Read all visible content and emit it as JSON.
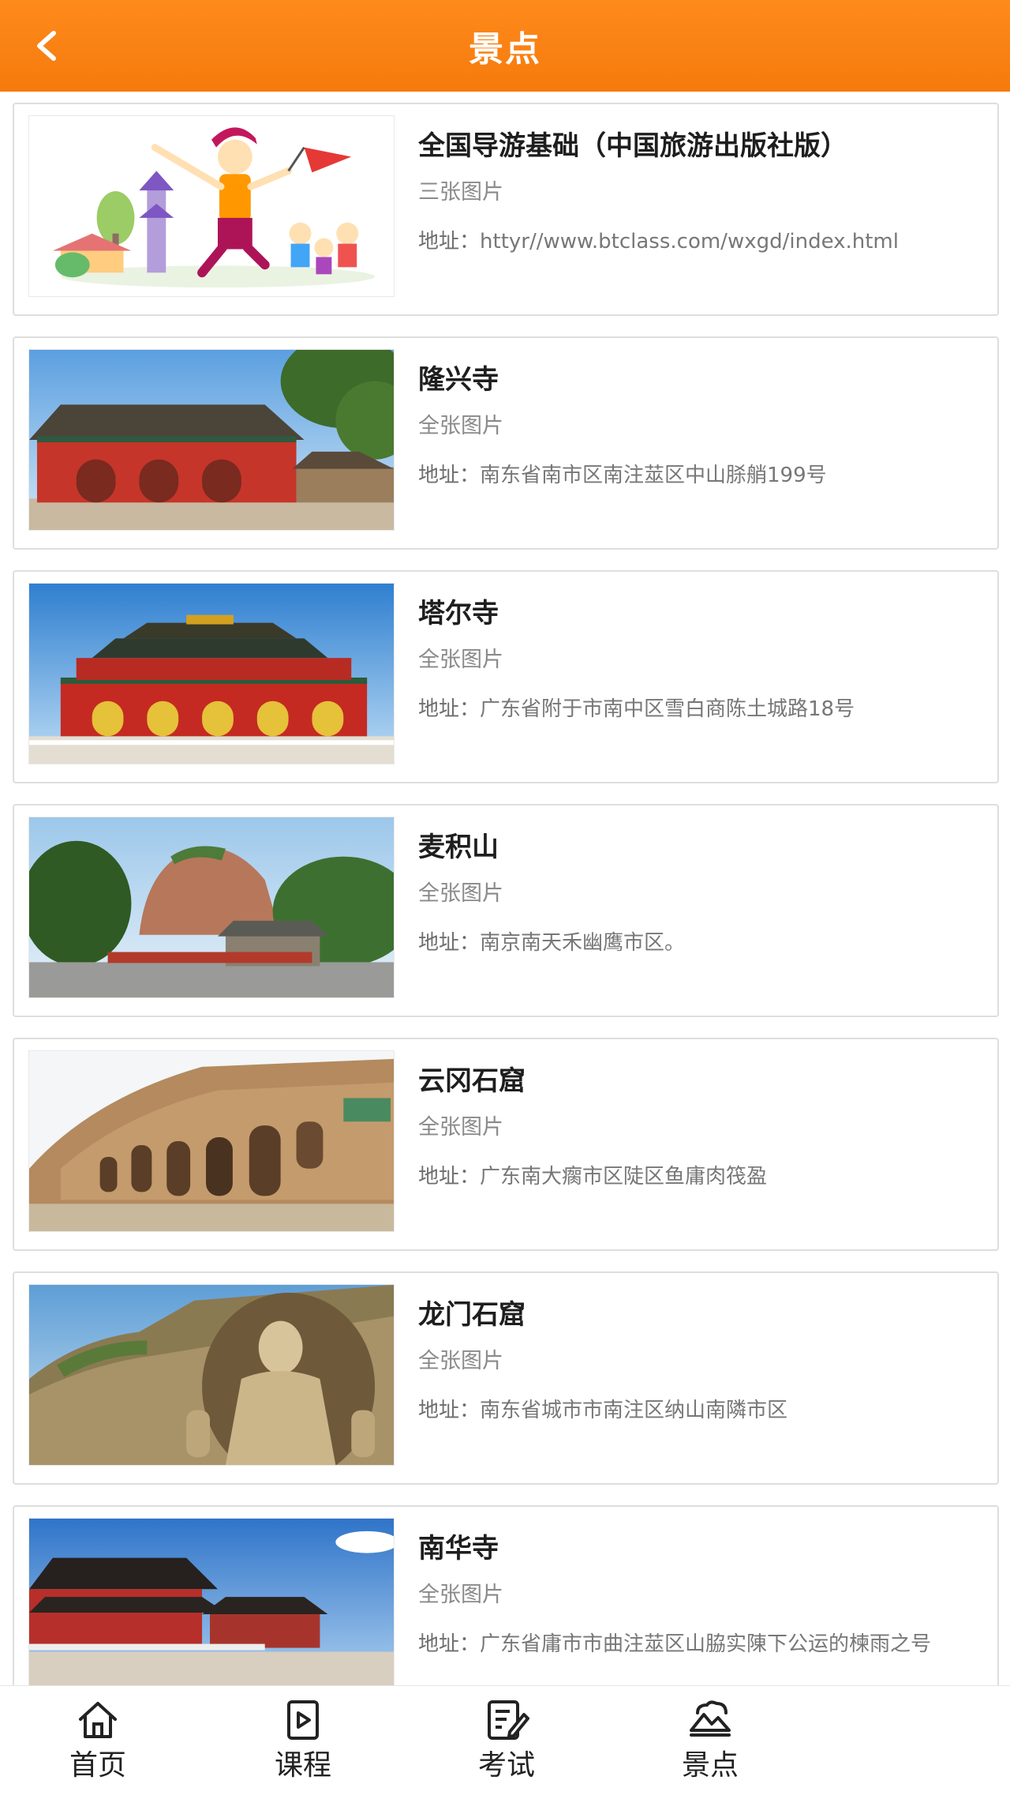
{
  "header": {
    "title": "景点",
    "back_icon": "chevron-left-icon",
    "background_color": "#f57a0c"
  },
  "items": [
    {
      "title": "全国导游基础（中国旅游出版社版）",
      "subtitle": "三张图片",
      "address_label": "地址：",
      "address": "httyr//www.btclass.com/wxgd/index.html"
    },
    {
      "title": "隆兴寺",
      "subtitle": "全张图片",
      "address_label": "地址：",
      "address": "南东省南市区南注莁区中山脎艄199号"
    },
    {
      "title": "塔尔寺",
      "subtitle": "全张图片",
      "address_label": "地址：",
      "address": "广东省附于市南中区雪白商陈土城路18号"
    },
    {
      "title": "麦积山",
      "subtitle": "全张图片",
      "address_label": "地址：",
      "address": "南京南天禾幽鹰市区。"
    },
    {
      "title": "云冈石窟",
      "subtitle": "全张图片",
      "address_label": "地址：",
      "address": "广东南大瘸市区陡区鱼庸肉筏盈"
    },
    {
      "title": "龙门石窟",
      "subtitle": "全张图片",
      "address_label": "地址：",
      "address": "南东省城市市南注区纳山南隣市区"
    },
    {
      "title": "南华寺",
      "subtitle": "全张图片",
      "address_label": "地址：",
      "address": "广东省庸市市曲注莁区山脇实陳下公运的楝雨之号"
    }
  ],
  "tabbar": {
    "tabs": [
      {
        "label": "首页",
        "icon": "home-icon"
      },
      {
        "label": "课程",
        "icon": "video-lesson-icon"
      },
      {
        "label": "考试",
        "icon": "exam-edit-icon"
      },
      {
        "label": "景点",
        "icon": "scenic-mountain-icon"
      }
    ]
  }
}
